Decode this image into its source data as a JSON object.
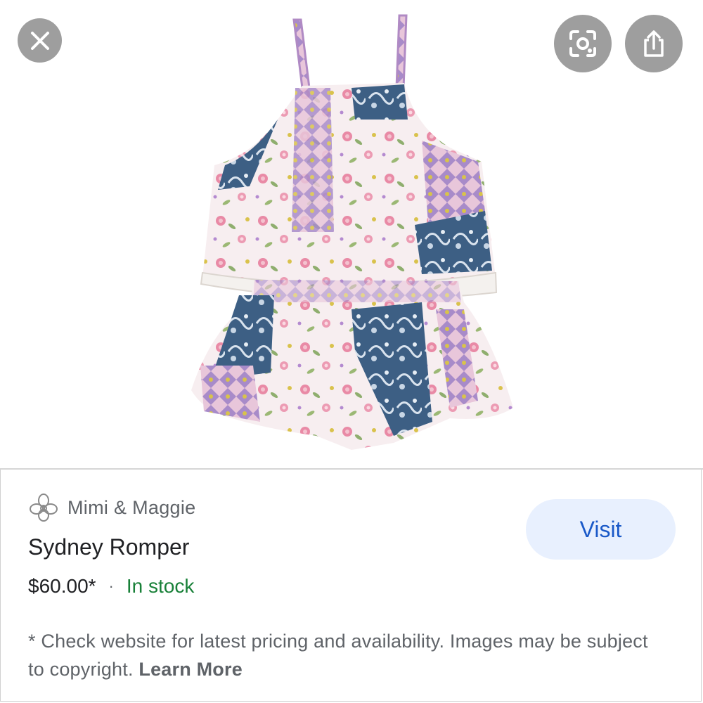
{
  "icons": {
    "close": "close-icon",
    "lens": "lens-icon",
    "share": "share-icon",
    "merchant_logo": "flower-logo-icon"
  },
  "merchant": {
    "name": "Mimi & Maggie"
  },
  "product": {
    "title": "Sydney Romper",
    "price": "$60.00*",
    "separator": "·",
    "stock": "In stock"
  },
  "actions": {
    "visit_label": "Visit"
  },
  "disclaimer": {
    "text": "* Check website for latest pricing and availability. Images may be subject to copyright. ",
    "link": "Learn More"
  },
  "colors": {
    "stock_green": "#188038",
    "visit_blue": "#1a59c8",
    "visit_bg": "#e8f0fe",
    "overlay_button": "#9e9e9e"
  }
}
